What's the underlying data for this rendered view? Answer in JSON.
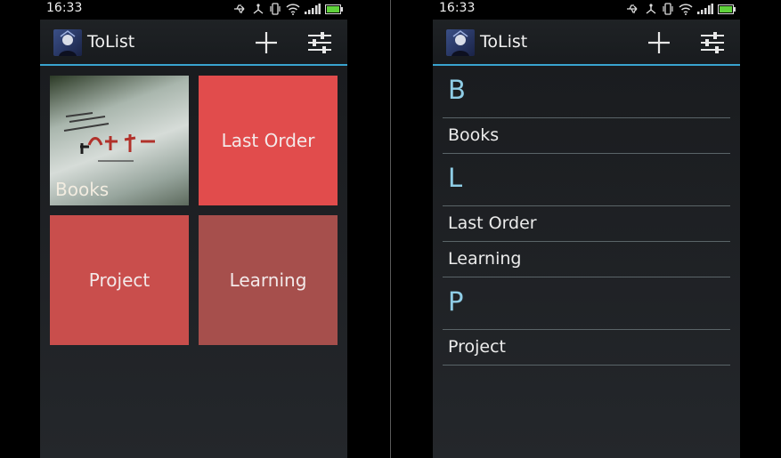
{
  "status_bar": {
    "time": "16:33"
  },
  "app": {
    "title": "ToList",
    "accent": "#39a3cf"
  },
  "actions": {
    "add": "add-icon",
    "settings": "sliders-icon"
  },
  "grid": {
    "tiles": [
      {
        "label": "Books",
        "color": "#8fa39a"
      },
      {
        "label": "Last Order",
        "color": "#e14c4c"
      },
      {
        "label": "Project",
        "color": "#c94e4c"
      },
      {
        "label": "Learning",
        "color": "#a64f4c"
      }
    ]
  },
  "list": {
    "sections": [
      {
        "letter": "B",
        "items": [
          "Books"
        ]
      },
      {
        "letter": "L",
        "items": [
          "Last Order",
          "Learning"
        ]
      },
      {
        "letter": "P",
        "items": [
          "Project"
        ]
      }
    ]
  }
}
